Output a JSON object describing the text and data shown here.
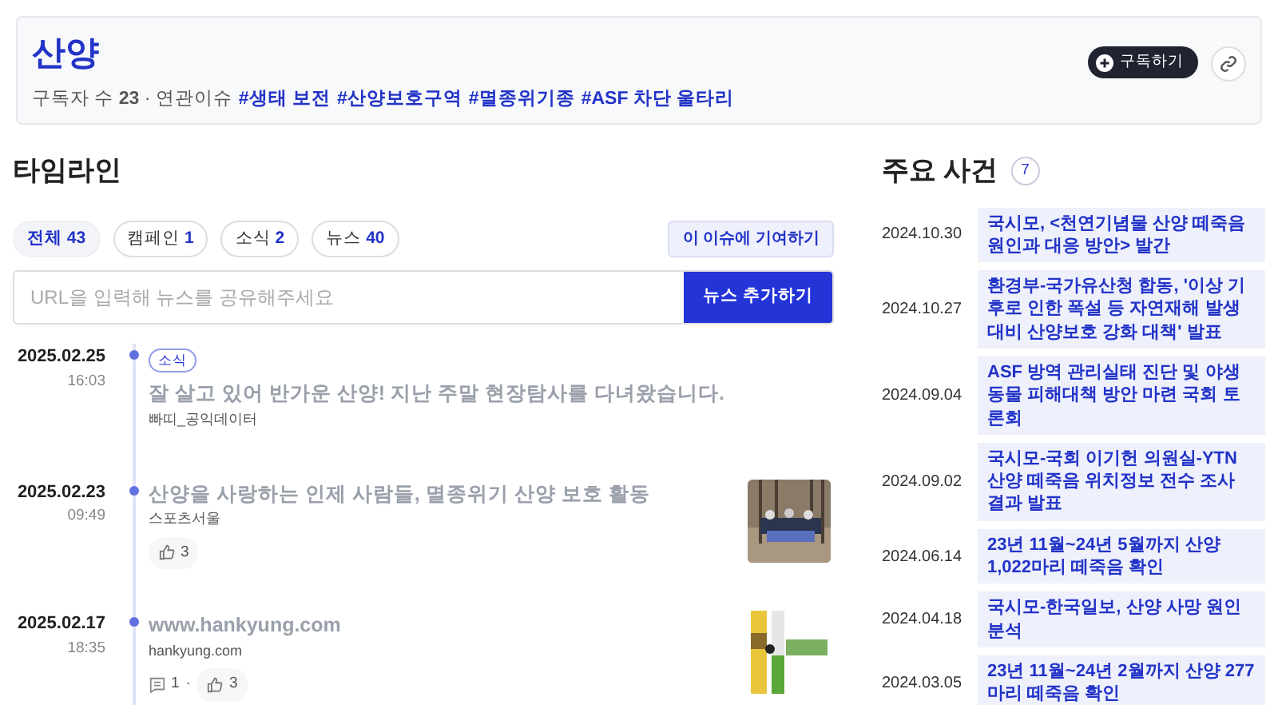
{
  "issue": {
    "title": "산양",
    "meta": "구독자 수 **23** · 연관이슈",
    "tags": [
      "#생태 보전",
      "#산양보호구역",
      "#멸종위기종",
      "#ASF 차단 울타리"
    ],
    "subscribe_button": "구독하기"
  },
  "timeline": {
    "heading": "타임라인",
    "filters": [
      {
        "label": "전체",
        "count": "43",
        "selected": true
      },
      {
        "label": "캠페인",
        "count": "1",
        "selected": false
      },
      {
        "label": "소식",
        "count": "2",
        "selected": false
      },
      {
        "label": "뉴스",
        "count": "40",
        "selected": false
      }
    ],
    "contribute_button": "이 이슈에 기여하기",
    "url_input": {
      "placeholder": "URL을 입력해 뉴스를 공유해주세요"
    },
    "add_button": "뉴스 추가하기",
    "entries": [
      {
        "date": "2025.02.25",
        "time": "16:03",
        "badge": "소식",
        "title": "잘 살고 있어 반가운 산양! 지난 주말 현장탐사를 다녀왔습니다.",
        "source": "빠띠_공익데이터"
      },
      {
        "date": "2025.02.23",
        "time": "09:49",
        "title": "산양을 사랑하는 인제 사람들, 멸종위기 산양 보호 활동",
        "source": "스포츠서울",
        "likes": "3"
      },
      {
        "date": "2025.02.17",
        "time": "18:35",
        "title": "www.hankyung.com",
        "source": "hankyung.com",
        "comments": "1",
        "separator": "·",
        "likes": "3"
      }
    ]
  },
  "events": {
    "heading": "주요 사건",
    "count": "7",
    "items": [
      {
        "date": "2024.10.30",
        "text": "국시모, <천연기념물 산양 떼죽음 원인과 대응 방안> 발간"
      },
      {
        "date": "2024.10.27",
        "text": "환경부-국가유산청 합동, '이상 기후로 인한 폭설 등 자연재해 발생 대비 산양보호 강화 대책' 발표"
      },
      {
        "date": "2024.09.04",
        "text": "ASF 방역 관리실태 진단 및 야생동물 피해대책 방안 마련 국회 토론회"
      },
      {
        "date": "2024.09.02",
        "text": "국시모-국회 이기헌 의원실-YTN 산양 떼죽음 위치정보 전수 조사 결과 발표"
      },
      {
        "date": "2024.06.14",
        "text": "23년 11월~24년 5월까지 산양 1,022마리 떼죽음 확인"
      },
      {
        "date": "2024.04.18",
        "text": "국시모-한국일보, 산양 사망 원인 분석"
      },
      {
        "date": "2024.03.05",
        "text": "23년 11월~24년 2월까지 산양 277마리 떼죽음 확인"
      }
    ]
  }
}
